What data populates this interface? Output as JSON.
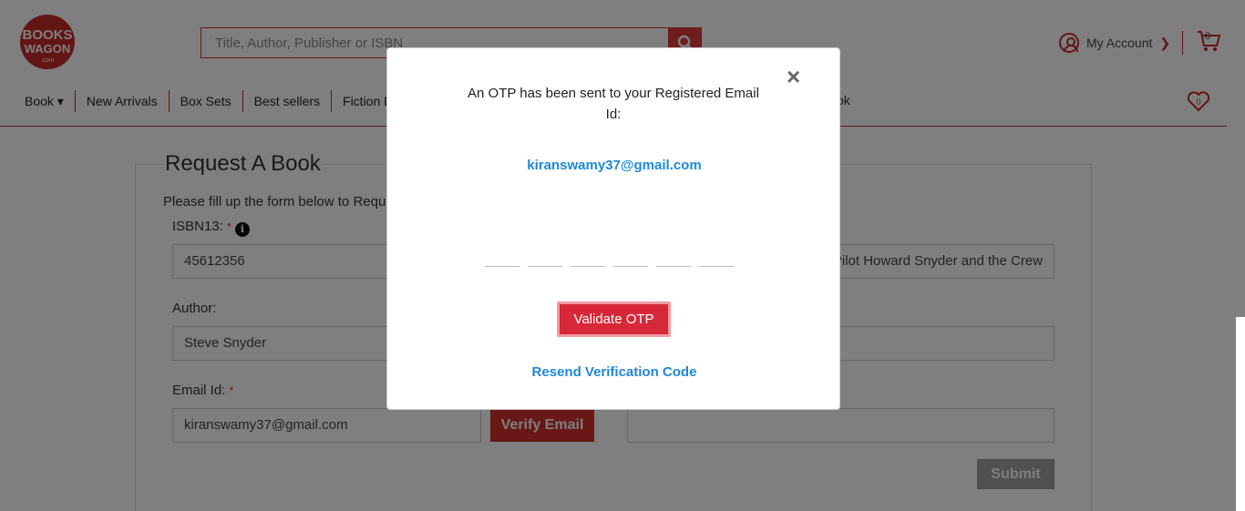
{
  "brand": {
    "logo_line1": "BOOKS",
    "logo_line2": "WAGON",
    "logo_suffix": ".com",
    "accent": "#c62828"
  },
  "search": {
    "placeholder": "Title, Author, Publisher or ISBN",
    "icon": "search-icon"
  },
  "account": {
    "label": "My Account",
    "cart_count": "0"
  },
  "nav": {
    "items": [
      {
        "label": "Book ▾"
      },
      {
        "label": "New Arrivals"
      },
      {
        "label": "Box Sets"
      },
      {
        "label": "Best sellers"
      },
      {
        "label": "Fiction Books"
      }
    ],
    "right_item": "ok",
    "wishlist_count": "0"
  },
  "form": {
    "title": "Request A Book",
    "intro": "Please fill up the form below to Request a Book",
    "isbn_label": "ISBN13:",
    "isbn_value": "45612356",
    "title_value": "Pilot Howard Snyder and the Crew",
    "author_label": "Author:",
    "author_value": "Steve Snyder",
    "email_label": "Email Id:",
    "email_value": "kiranswamy37@gmail.com",
    "verify_label": "Verify Email",
    "submit_label": "Submit",
    "required_mark": "*",
    "info_glyph": "i"
  },
  "modal": {
    "message": "An OTP has been sent to your Registered Email Id:",
    "email": "kiranswamy37@gmail.com",
    "otp_digits": [
      "",
      "",
      "",
      "",
      "",
      ""
    ],
    "validate_label": "Validate OTP",
    "resend_label": "Resend Verification Code",
    "close_glyph": "×"
  }
}
